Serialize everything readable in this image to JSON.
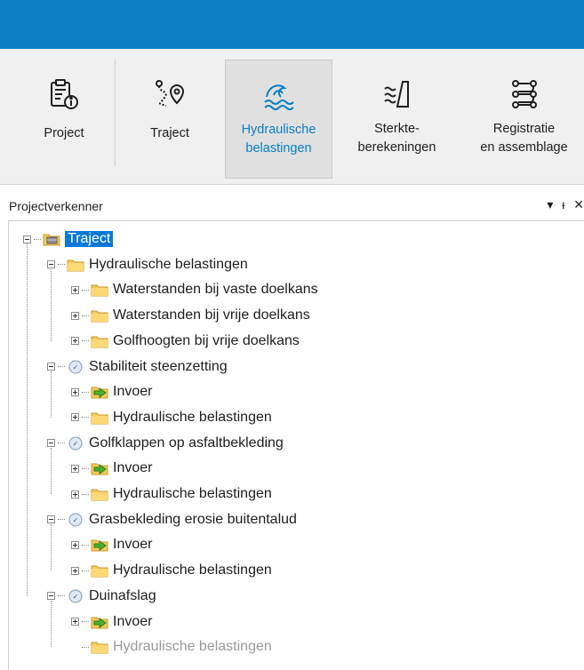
{
  "colors": {
    "accent": "#0a7fc4",
    "selection": "#0a78d7"
  },
  "ribbon": {
    "buttons": [
      {
        "id": "project",
        "label": "Project",
        "icon": "clipboard-info-icon"
      },
      {
        "id": "traject",
        "label": "Traject",
        "icon": "route-pin-icon"
      },
      {
        "id": "hydraulische",
        "label": "Hydraulische\nbelastingen",
        "icon": "waves-icon",
        "active": true
      },
      {
        "id": "sterkte",
        "label": "Sterkte-\nberekeningen",
        "icon": "dike-icon"
      },
      {
        "id": "registratie",
        "label": "Registratie\nen assemblage",
        "icon": "flow-icon"
      }
    ]
  },
  "panel": {
    "title": "Projectverkenner",
    "pin_glyph": "▾",
    "dock_glyph": "ᵻ",
    "close_glyph": "✕"
  },
  "tree": [
    {
      "level": 0,
      "expander": "minus",
      "icon": "traject",
      "label": "Traject",
      "selected": true
    },
    {
      "level": 1,
      "expander": "minus",
      "icon": "folder",
      "label": "Hydraulische belastingen"
    },
    {
      "level": 2,
      "expander": "plus",
      "icon": "folder",
      "label": "Waterstanden bij vaste doelkans"
    },
    {
      "level": 2,
      "expander": "plus",
      "icon": "folder",
      "label": "Waterstanden bij vrije doelkans"
    },
    {
      "level": 2,
      "expander": "plus",
      "icon": "folder",
      "label": "Golfhoogten bij vrije doelkans"
    },
    {
      "level": 1,
      "expander": "minus",
      "icon": "failure",
      "label": "Stabiliteit steenzetting"
    },
    {
      "level": 2,
      "expander": "plus",
      "icon": "input",
      "label": "Invoer"
    },
    {
      "level": 2,
      "expander": "plus",
      "icon": "folder",
      "label": "Hydraulische belastingen"
    },
    {
      "level": 1,
      "expander": "minus",
      "icon": "failure",
      "label": "Golfklappen op asfaltbekleding"
    },
    {
      "level": 2,
      "expander": "plus",
      "icon": "input",
      "label": "Invoer"
    },
    {
      "level": 2,
      "expander": "plus",
      "icon": "folder",
      "label": "Hydraulische belastingen"
    },
    {
      "level": 1,
      "expander": "minus",
      "icon": "failure",
      "label": "Grasbekleding erosie buitentalud"
    },
    {
      "level": 2,
      "expander": "plus",
      "icon": "input",
      "label": "Invoer"
    },
    {
      "level": 2,
      "expander": "plus",
      "icon": "folder",
      "label": "Hydraulische belastingen"
    },
    {
      "level": 1,
      "expander": "minus",
      "icon": "failure",
      "label": "Duinafslag"
    },
    {
      "level": 2,
      "expander": "plus",
      "icon": "input",
      "label": "Invoer"
    },
    {
      "level": 2,
      "expander": "none",
      "icon": "folder",
      "label": "Hydraulische belastingen",
      "dim": true
    }
  ]
}
